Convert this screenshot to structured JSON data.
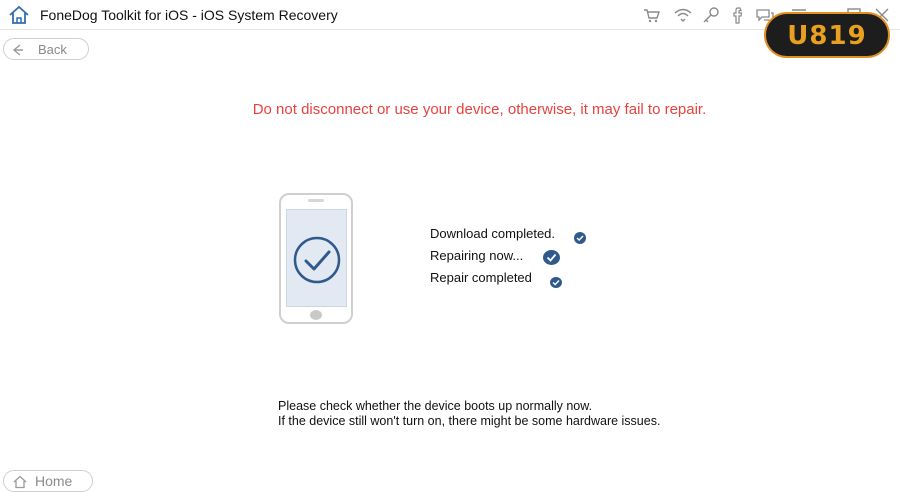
{
  "window": {
    "title": "FoneDog Toolkit for iOS - iOS System Recovery",
    "toolbar_icons": [
      "cart-icon",
      "wifi-icon",
      "key-icon",
      "facebook-icon",
      "chat-icon",
      "menu-icon",
      "minimize-icon",
      "maximize-icon",
      "close-icon"
    ]
  },
  "badge": {
    "text": "U819"
  },
  "nav": {
    "back_label": "Back",
    "home_label": "Home"
  },
  "main": {
    "warning": "Do not disconnect or use your device, otherwise, it may fail to repair.",
    "steps": [
      {
        "label": "Download completed.",
        "status": "done"
      },
      {
        "label": "Repairing now...",
        "status": "done"
      },
      {
        "label": "Repair completed",
        "status": "done"
      }
    ],
    "info_line1": "Please check whether the device boots up normally now.",
    "info_line2": "If the device still won't turn on, there might be some hardware issues."
  },
  "colors": {
    "warning": "#e8423f",
    "check_blue": "#2f5a8c",
    "badge_bg": "#1d1d1d",
    "badge_accent": "#e09020"
  }
}
